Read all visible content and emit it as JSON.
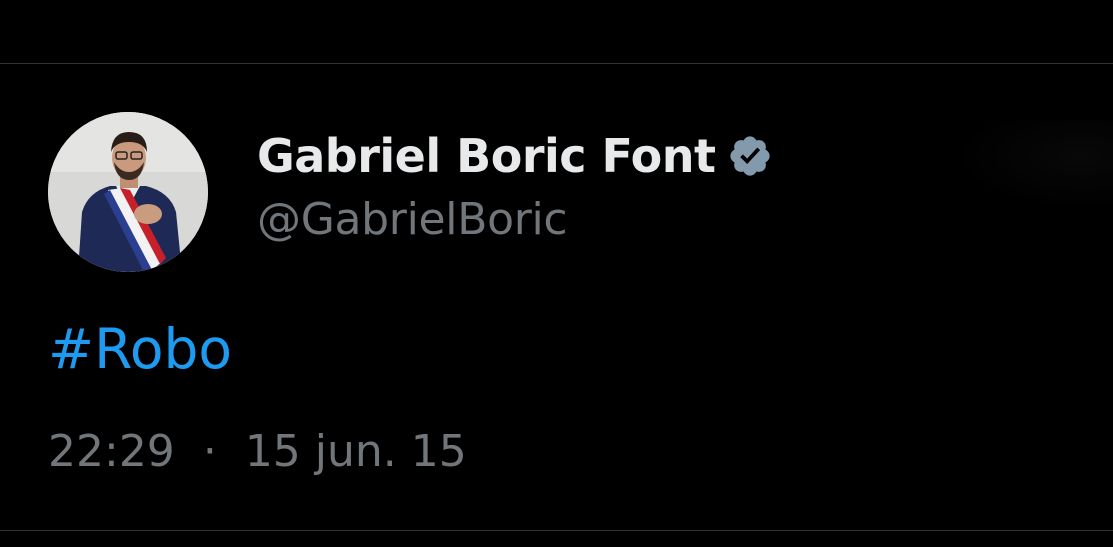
{
  "tweet": {
    "author": {
      "display_name": "Gabriel Boric Font",
      "handle": "@GabrielBoric",
      "verified_icon": "verified-badge-icon",
      "avatar": "profile-avatar"
    },
    "text": "#Robo",
    "time": "22:29",
    "separator": "·",
    "date": "15 jun. 15"
  },
  "colors": {
    "background": "#000000",
    "name": "#e7e9ea",
    "secondary": "#71767b",
    "hashtag": "#1d9bf0",
    "divider": "#2f3336",
    "verified_badge": "#829aab"
  }
}
